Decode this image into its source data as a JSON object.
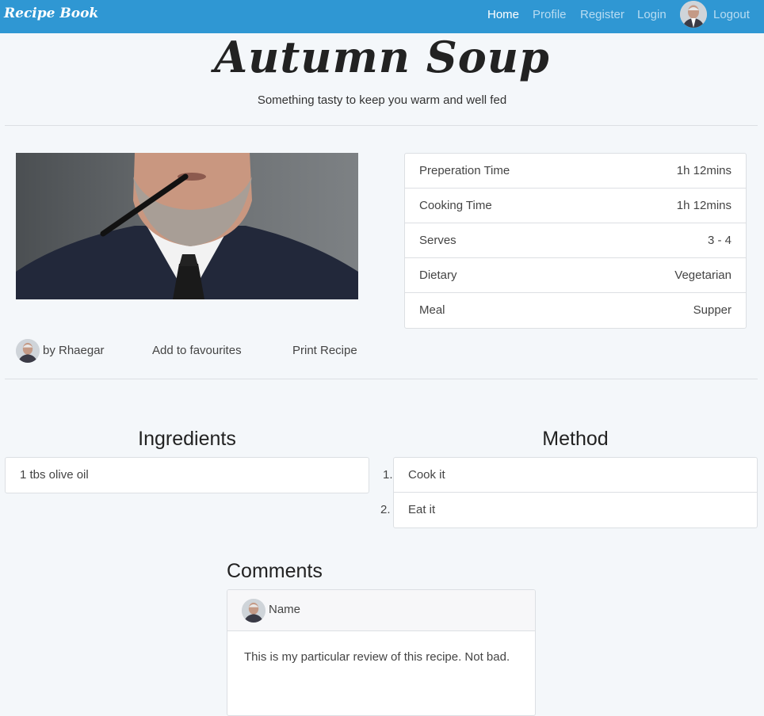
{
  "nav": {
    "brand": "Recipe Book",
    "links": [
      "Home",
      "Profile",
      "Register",
      "Login",
      "Logout"
    ],
    "active": "Home",
    "color": "#2f97d3"
  },
  "recipe": {
    "title": "Autumn Soup",
    "subtitle": "Something tasty to keep you warm and well fed",
    "info": [
      {
        "key": "Preperation Time",
        "value": "1h 12mins"
      },
      {
        "key": "Cooking Time",
        "value": "1h 12mins"
      },
      {
        "key": "Serves",
        "value": "3 - 4"
      },
      {
        "key": "Dietary",
        "value": "Vegetarian"
      },
      {
        "key": "Meal",
        "value": "Supper"
      }
    ],
    "author": "by Rhaegar",
    "actions": {
      "favourite": "Add to favourites",
      "print": "Print Recipe"
    }
  },
  "ingredients": {
    "heading": "Ingredients",
    "items": [
      "1 tbs olive oil"
    ]
  },
  "method": {
    "heading": "Method",
    "steps": [
      {
        "num": "1.",
        "text": "Cook it"
      },
      {
        "num": "2.",
        "text": "Eat it"
      }
    ]
  },
  "comments": {
    "heading": "Comments",
    "items": [
      {
        "name": "Name",
        "text": "This is my particular review of this recipe. Not bad."
      }
    ]
  },
  "icons": {
    "avatar": "user-avatar-icon",
    "hero": "recipe-hero-image"
  }
}
